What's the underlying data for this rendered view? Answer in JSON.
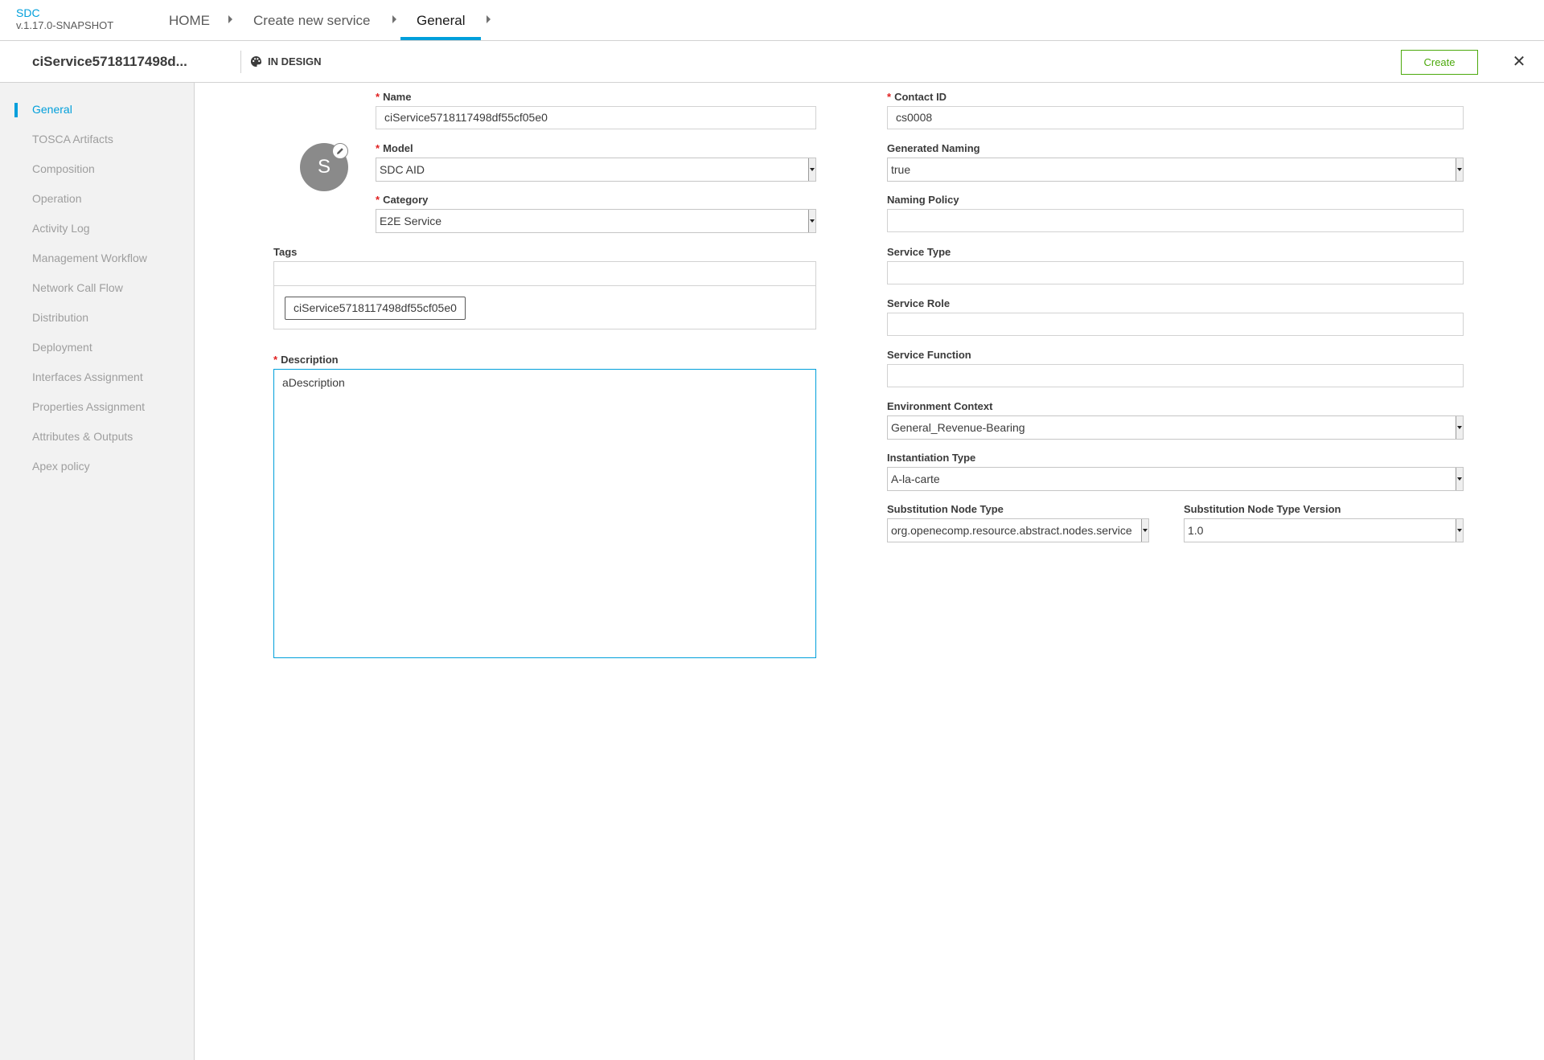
{
  "app": {
    "name": "SDC",
    "version": "v.1.17.0-SNAPSHOT"
  },
  "breadcrumbs": [
    {
      "label": "HOME"
    },
    {
      "label": "Create new service"
    },
    {
      "label": "General"
    }
  ],
  "subheader": {
    "service_name": "ciService5718117498d...",
    "status": "IN DESIGN",
    "create_label": "Create",
    "close_icon": "close-icon"
  },
  "sidebar": {
    "items": [
      {
        "label": "General",
        "active": true
      },
      {
        "label": "TOSCA Artifacts"
      },
      {
        "label": "Composition"
      },
      {
        "label": "Operation"
      },
      {
        "label": "Activity Log"
      },
      {
        "label": "Management Workflow"
      },
      {
        "label": "Network Call Flow"
      },
      {
        "label": "Distribution"
      },
      {
        "label": "Deployment"
      },
      {
        "label": "Interfaces Assignment"
      },
      {
        "label": "Properties Assignment"
      },
      {
        "label": "Attributes & Outputs"
      },
      {
        "label": "Apex policy"
      }
    ]
  },
  "form": {
    "icon_letter": "S",
    "name": {
      "label": "Name",
      "value": "ciService5718117498df55cf05e0"
    },
    "model": {
      "label": "Model",
      "value": "SDC AID"
    },
    "category": {
      "label": "Category",
      "value": "E2E Service"
    },
    "tags": {
      "label": "Tags",
      "items": [
        "ciService5718117498df55cf05e0"
      ]
    },
    "description": {
      "label": "Description",
      "value": "aDescription"
    },
    "contact_id": {
      "label": "Contact ID",
      "value": "cs0008"
    },
    "generated_naming": {
      "label": "Generated Naming",
      "value": "true"
    },
    "naming_policy": {
      "label": "Naming Policy",
      "value": ""
    },
    "service_type": {
      "label": "Service Type",
      "value": ""
    },
    "service_role": {
      "label": "Service Role",
      "value": ""
    },
    "service_function": {
      "label": "Service Function",
      "value": ""
    },
    "environment_context": {
      "label": "Environment Context",
      "value": "General_Revenue-Bearing"
    },
    "instantiation_type": {
      "label": "Instantiation Type",
      "value": "A-la-carte"
    },
    "substitution_node_type": {
      "label": "Substitution Node Type",
      "value": "org.openecomp.resource.abstract.nodes.service"
    },
    "substitution_node_type_version": {
      "label": "Substitution Node Type Version",
      "value": "1.0"
    }
  },
  "colors": {
    "accent": "#009fdb",
    "create": "#4ca90c",
    "required": "#e02020"
  }
}
